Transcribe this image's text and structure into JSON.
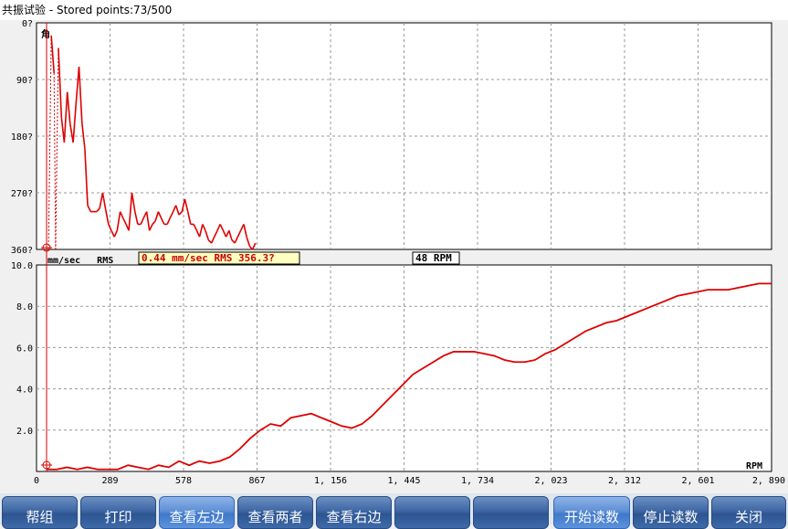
{
  "window": {
    "title": "共振试验 - Stored points:73/500"
  },
  "top_readout": {
    "text": "0.44 mm/sec RMS 356.3?"
  },
  "rpm_readout": {
    "text": "48 RPM"
  },
  "colors": {
    "series": "#dd0000",
    "grid": "#999999",
    "plot_bg": "#ffffff",
    "readout_text": "#cc0000"
  },
  "buttons": [
    {
      "label": "帮组",
      "active": false
    },
    {
      "label": "打印",
      "active": false
    },
    {
      "label": "查看左边",
      "active": true
    },
    {
      "label": "查看两者",
      "active": false
    },
    {
      "label": "查看右边",
      "active": false
    },
    {
      "label": "",
      "active": false
    },
    {
      "label": "",
      "active": false
    },
    {
      "label": "开始读数",
      "active": true
    },
    {
      "label": "停止读数",
      "active": false
    },
    {
      "label": "关闭",
      "active": false
    }
  ],
  "chart_data": [
    {
      "type": "line",
      "title": "",
      "ylabel": "角",
      "xlabel": "",
      "y_reversed": true,
      "ylim": [
        0,
        360
      ],
      "y_ticks": [
        "0?",
        "90?",
        "180?",
        "270?",
        "360?"
      ],
      "y_tick_values": [
        0,
        90,
        180,
        270,
        360
      ],
      "xlim": [
        0,
        2890
      ],
      "grid": true,
      "series": [
        {
          "x": [
            47,
            58,
            69,
            75,
            86,
            98,
            109,
            121,
            132,
            144,
            155,
            167,
            179,
            190,
            201,
            213,
            224,
            236,
            248,
            260,
            271,
            283,
            294,
            306,
            317,
            329,
            340,
            352,
            363,
            375,
            387,
            398,
            410,
            421,
            433,
            444,
            456,
            467,
            479,
            490,
            502,
            514,
            525,
            537,
            548,
            560,
            572,
            583,
            595,
            606,
            618,
            630,
            641,
            653,
            664,
            676,
            688,
            699,
            711,
            722,
            734,
            745,
            757,
            768,
            780,
            791,
            803,
            815,
            826,
            838,
            849,
            861
          ],
          "y": [
            360,
            20,
            80,
            360,
            40,
            150,
            190,
            110,
            160,
            190,
            130,
            70,
            160,
            200,
            290,
            300,
            300,
            300,
            295,
            270,
            295,
            320,
            330,
            340,
            330,
            300,
            310,
            320,
            330,
            270,
            300,
            320,
            320,
            310,
            300,
            330,
            320,
            315,
            300,
            310,
            320,
            320,
            310,
            300,
            290,
            305,
            300,
            280,
            300,
            320,
            320,
            330,
            340,
            320,
            330,
            345,
            350,
            340,
            330,
            320,
            330,
            340,
            330,
            345,
            350,
            340,
            330,
            320,
            340,
            355,
            360,
            350
          ]
        }
      ]
    },
    {
      "type": "line",
      "title": "",
      "ylabel": "mm/sec   RMS",
      "xlabel": "RPM",
      "ylim": [
        0,
        10
      ],
      "y_ticks": [
        "2.0",
        "4.0",
        "6.0",
        "8.0",
        "10.0"
      ],
      "y_tick_values": [
        2,
        4,
        6,
        8,
        10
      ],
      "xlim": [
        0,
        2890
      ],
      "x_ticks": [
        "0",
        "289",
        "578",
        "867",
        "1, 156",
        "1, 445",
        "1, 734",
        "2, 023",
        "2, 312",
        "2, 601",
        "2, 890"
      ],
      "x_tick_values": [
        0,
        289,
        578,
        867,
        1156,
        1445,
        1734,
        2023,
        2312,
        2601,
        2890
      ],
      "grid": true,
      "series": [
        {
          "x": [
            40,
            80,
            120,
            160,
            200,
            240,
            280,
            320,
            360,
            400,
            440,
            480,
            520,
            560,
            600,
            640,
            680,
            720,
            760,
            800,
            840,
            880,
            920,
            960,
            1000,
            1040,
            1080,
            1120,
            1160,
            1200,
            1240,
            1280,
            1320,
            1360,
            1400,
            1440,
            1480,
            1520,
            1560,
            1600,
            1640,
            1680,
            1720,
            1760,
            1800,
            1840,
            1880,
            1920,
            1960,
            2000,
            2040,
            2080,
            2120,
            2160,
            2200,
            2240,
            2280,
            2320,
            2360,
            2400,
            2440,
            2480,
            2520,
            2560,
            2600,
            2640,
            2680,
            2720,
            2760,
            2800,
            2840,
            2890
          ],
          "y": [
            0.1,
            0.1,
            0.2,
            0.1,
            0.2,
            0.1,
            0.1,
            0.1,
            0.3,
            0.2,
            0.1,
            0.3,
            0.2,
            0.5,
            0.3,
            0.5,
            0.4,
            0.5,
            0.7,
            1.1,
            1.6,
            2.0,
            2.3,
            2.2,
            2.6,
            2.7,
            2.8,
            2.6,
            2.4,
            2.2,
            2.1,
            2.3,
            2.7,
            3.2,
            3.7,
            4.2,
            4.7,
            5.0,
            5.3,
            5.6,
            5.8,
            5.8,
            5.8,
            5.7,
            5.6,
            5.4,
            5.3,
            5.3,
            5.4,
            5.7,
            5.9,
            6.2,
            6.5,
            6.8,
            7.0,
            7.2,
            7.3,
            7.5,
            7.7,
            7.9,
            8.1,
            8.3,
            8.5,
            8.6,
            8.7,
            8.8,
            8.8,
            8.8,
            8.9,
            9.0,
            9.1,
            9.1
          ]
        }
      ]
    }
  ]
}
